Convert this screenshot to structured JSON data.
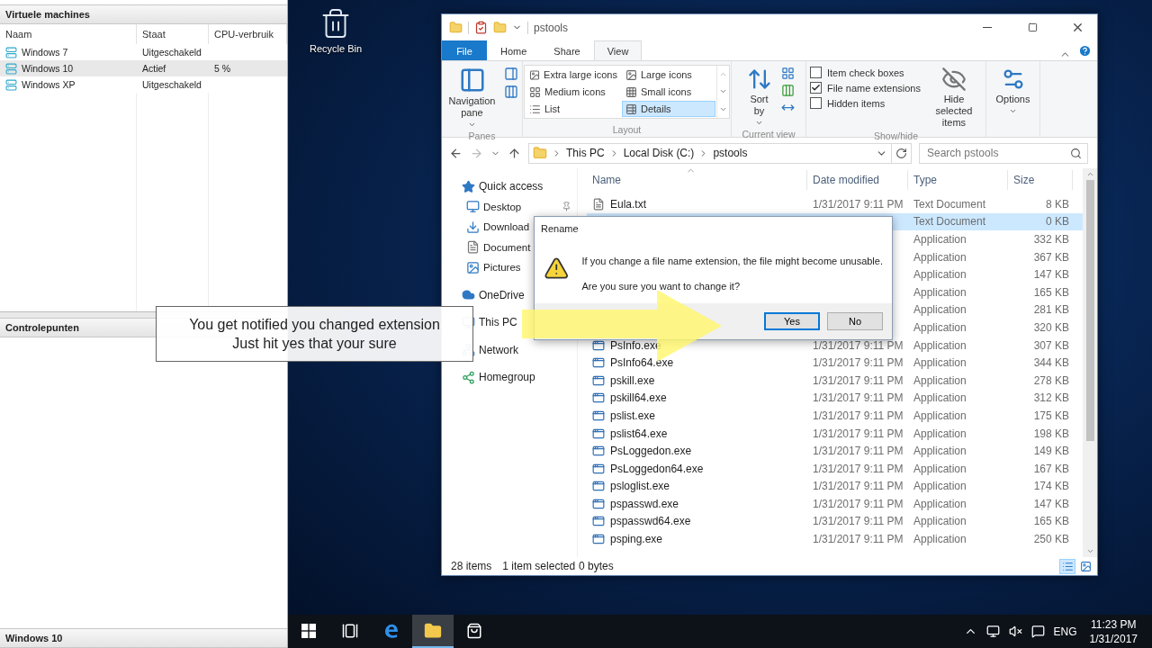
{
  "vm_manager": {
    "title": "Virtuele machines",
    "columns": [
      "Naam",
      "Staat",
      "CPU-verbruik"
    ],
    "rows": [
      {
        "name": "Windows 7",
        "state": "Uitgeschakeld",
        "selected": false
      },
      {
        "name": "Windows 10",
        "state": "Actief",
        "cpu": "5 %",
        "selected": true
      },
      {
        "name": "Windows XP",
        "state": "Uitgeschakeld",
        "selected": false
      }
    ],
    "checkpoints_title": "Controlepunten",
    "details_title": "Windows 10"
  },
  "desktop_icons": [
    {
      "label": "Recycle Bin"
    }
  ],
  "explorer": {
    "title": "pstools",
    "tabs": [
      {
        "label": "File",
        "kind": "file",
        "selected": false
      },
      {
        "label": "Home",
        "kind": "tab",
        "selected": false
      },
      {
        "label": "Share",
        "kind": "tab",
        "selected": false
      },
      {
        "label": "View",
        "kind": "tab",
        "selected": true
      }
    ],
    "ribbon": [
      {
        "kind": "panes",
        "label": "Panes",
        "button": "Navigation pane"
      },
      {
        "kind": "layout",
        "label": "Layout",
        "options": [
          {
            "label": "Extra large icons",
            "selected": false
          },
          {
            "label": "Large icons",
            "selected": false
          },
          {
            "label": "Medium icons",
            "selected": false
          },
          {
            "label": "Small icons",
            "selected": false
          },
          {
            "label": "List",
            "selected": false
          },
          {
            "label": "Details",
            "selected": true
          }
        ]
      },
      {
        "kind": "current_view",
        "label": "Current view",
        "button": "Sort by"
      },
      {
        "kind": "show_hide",
        "label": "Show/hide",
        "checkboxes": [
          {
            "label": "Item check boxes",
            "checked": false
          },
          {
            "label": "File name extensions",
            "checked": true
          },
          {
            "label": "Hidden items",
            "checked": false
          }
        ],
        "button": "Hide selected items"
      },
      {
        "kind": "options",
        "button": "Options"
      }
    ],
    "address": {
      "path": [
        "This PC",
        "Local Disk (C:)",
        "pstools"
      ],
      "search_placeholder": "Search pstools"
    },
    "nav": [
      {
        "label": "Quick access",
        "kind": "quick_access",
        "children": [
          {
            "label": "Desktop",
            "kind": "desktop",
            "pinned": true
          },
          {
            "label": "Download",
            "kind": "downloads"
          },
          {
            "label": "Document",
            "kind": "documents"
          },
          {
            "label": "Pictures",
            "kind": "pictures"
          }
        ]
      },
      {
        "label": "OneDrive",
        "kind": "cloud"
      },
      {
        "label": "This PC",
        "kind": "pc"
      },
      {
        "label": "Network",
        "kind": "network"
      },
      {
        "label": "Homegroup",
        "kind": "homegroup"
      }
    ],
    "columns": [
      "Name",
      "Date modified",
      "Type",
      "Size"
    ],
    "files": [
      {
        "name": "Eula.txt",
        "date": "1/31/2017 9:11 PM",
        "type": "Text Document",
        "size": "8 KB",
        "kind": "text",
        "selected": false
      },
      {
        "type": "Text Document",
        "size": "0 KB",
        "selected": true
      },
      {
        "type": "Application",
        "size": "332 KB",
        "selected": false
      },
      {
        "type": "Application",
        "size": "367 KB",
        "selected": false
      },
      {
        "type": "Application",
        "size": "147 KB",
        "selected": false
      },
      {
        "type": "Application",
        "size": "165 KB",
        "selected": false
      },
      {
        "type": "Application",
        "size": "281 KB",
        "selected": false
      },
      {
        "type": "Application",
        "size": "320 KB",
        "selected": false
      },
      {
        "name": "PsInfo.exe",
        "date": "1/31/2017 9:11 PM",
        "type": "Application",
        "size": "307 KB",
        "kind": "app",
        "selected": false
      },
      {
        "name": "PsInfo64.exe",
        "date": "1/31/2017 9:11 PM",
        "type": "Application",
        "size": "344 KB",
        "kind": "app",
        "selected": false
      },
      {
        "name": "pskill.exe",
        "date": "1/31/2017 9:11 PM",
        "type": "Application",
        "size": "278 KB",
        "kind": "app",
        "selected": false
      },
      {
        "name": "pskill64.exe",
        "date": "1/31/2017 9:11 PM",
        "type": "Application",
        "size": "312 KB",
        "kind": "app",
        "selected": false
      },
      {
        "name": "pslist.exe",
        "date": "1/31/2017 9:11 PM",
        "type": "Application",
        "size": "175 KB",
        "kind": "app",
        "selected": false
      },
      {
        "name": "pslist64.exe",
        "date": "1/31/2017 9:11 PM",
        "type": "Application",
        "size": "198 KB",
        "kind": "app",
        "selected": false
      },
      {
        "name": "PsLoggedon.exe",
        "date": "1/31/2017 9:11 PM",
        "type": "Application",
        "size": "149 KB",
        "kind": "app",
        "selected": false
      },
      {
        "name": "PsLoggedon64.exe",
        "date": "1/31/2017 9:11 PM",
        "type": "Application",
        "size": "167 KB",
        "kind": "app",
        "selected": false
      },
      {
        "name": "psloglist.exe",
        "date": "1/31/2017 9:11 PM",
        "type": "Application",
        "size": "174 KB",
        "kind": "app",
        "selected": false
      },
      {
        "name": "pspasswd.exe",
        "date": "1/31/2017 9:11 PM",
        "type": "Application",
        "size": "147 KB",
        "kind": "app",
        "selected": false
      },
      {
        "name": "pspasswd64.exe",
        "date": "1/31/2017 9:11 PM",
        "type": "Application",
        "size": "165 KB",
        "kind": "app",
        "selected": false
      },
      {
        "name": "psping.exe",
        "date": "1/31/2017 9:11 PM",
        "type": "Application",
        "size": "250 KB",
        "kind": "app",
        "selected": false
      }
    ],
    "status": {
      "count": "28 items",
      "selection": "1 item selected",
      "size": "0 bytes"
    },
    "view_buttons": [
      {
        "kind": "details",
        "selected": true
      },
      {
        "kind": "large_icons",
        "selected": false
      }
    ]
  },
  "dialog": {
    "title": "Rename",
    "message": "If you change a file name extension, the file might become unusable.",
    "question": "Are you sure you want to change it?",
    "buttons": [
      {
        "label": "Yes",
        "selected": true
      },
      {
        "label": "No",
        "selected": false
      }
    ]
  },
  "annotation": {
    "lines": [
      "You get notified you changed extension",
      "Just hit yes that your sure"
    ]
  },
  "taskbar": {
    "items": [
      {
        "kind": "start",
        "selected": false
      },
      {
        "kind": "task_view",
        "selected": false
      },
      {
        "kind": "browser",
        "selected": false
      },
      {
        "kind": "explorer",
        "selected": true
      },
      {
        "kind": "store",
        "selected": false
      }
    ],
    "language": "ENG",
    "time": "11:23 PM",
    "date": "1/31/2017"
  }
}
